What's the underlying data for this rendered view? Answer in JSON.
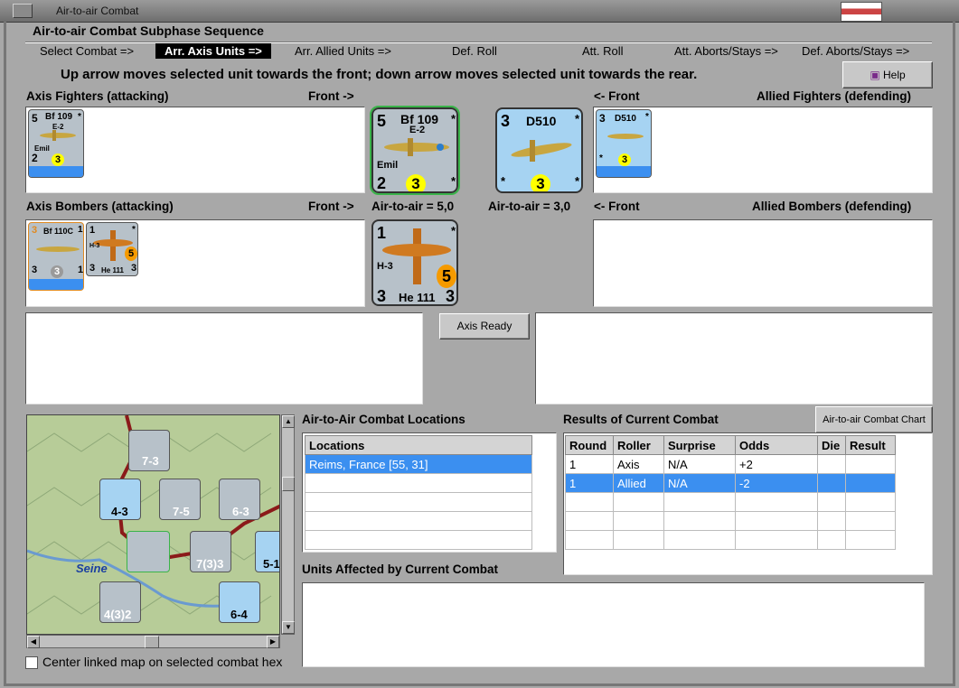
{
  "window": {
    "title": "Air-to-air Combat"
  },
  "sequence": {
    "header": "Air-to-air Combat Subphase Sequence",
    "steps": [
      "Select Combat =>",
      "Arr. Axis Units =>",
      "Arr. Allied Units =>",
      "Def. Roll",
      "Att. Roll",
      "Att. Aborts/Stays =>",
      "Def. Aborts/Stays =>"
    ],
    "active_index": 1
  },
  "instruction": "Up arrow moves selected unit towards the front; down arrow moves selected unit towards the rear.",
  "help_label": "Help",
  "labels": {
    "axis_fighters": "Axis Fighters (attacking)",
    "front_right": "Front ->",
    "front_left": "<- Front",
    "allied_fighters": "Allied Fighters (defending)",
    "axis_bombers": "Axis Bombers (attacking)",
    "allied_bombers": "Allied Bombers (defending)",
    "axis_air_to_air": "Air-to-air = 5,0",
    "allied_air_to_air": "Air-to-air = 3,0"
  },
  "axis_ready_label": "Axis Ready",
  "units": {
    "bf109": {
      "name": "Bf 109",
      "sub": "E-2",
      "pilot": "Emil",
      "tl": "5",
      "bl": "2",
      "circle": "3",
      "star": "*"
    },
    "d510": {
      "name": "D510",
      "tl": "3",
      "circle": "3",
      "star": "*"
    },
    "bf110": {
      "name": "Bf 110C",
      "tl": "3",
      "tr": "1",
      "bl": "3",
      "br": "1",
      "circle": "3"
    },
    "he111": {
      "name": "He 111",
      "sub": "H-3",
      "tl": "1",
      "bl": "3",
      "br": "3",
      "circle": "5",
      "star": "*"
    }
  },
  "map": {
    "river": "Seine",
    "units": [
      {
        "label": "7-3"
      },
      {
        "label": "4-3"
      },
      {
        "label": "7-5"
      },
      {
        "label": "6-3"
      },
      {
        "label": "7(3)3"
      },
      {
        "label": "4(3)2"
      },
      {
        "label": "6-4"
      },
      {
        "label": "5-1"
      }
    ],
    "center_checkbox_label": "Center linked map on selected combat hex"
  },
  "locations": {
    "title": "Air-to-Air Combat Locations",
    "header": "Locations",
    "rows": [
      "Reims, France [55, 31]"
    ]
  },
  "results": {
    "title": "Results of Current Combat",
    "chart_button": "Air-to-air Combat Chart",
    "columns": [
      "Round",
      "Roller",
      "Surprise",
      "Odds",
      "Die",
      "Result"
    ],
    "rows": [
      [
        "1",
        "Axis",
        "N/A",
        "+2",
        "",
        ""
      ],
      [
        "1",
        "Allied",
        "N/A",
        "-2",
        "",
        ""
      ]
    ],
    "selected_row": 1
  },
  "affected": {
    "title": "Units Affected by Current Combat"
  },
  "colors": {
    "axis_counter": "#b7c1c9",
    "allied_counter": "#a6d3f2",
    "selection": "#3b8ff0"
  }
}
